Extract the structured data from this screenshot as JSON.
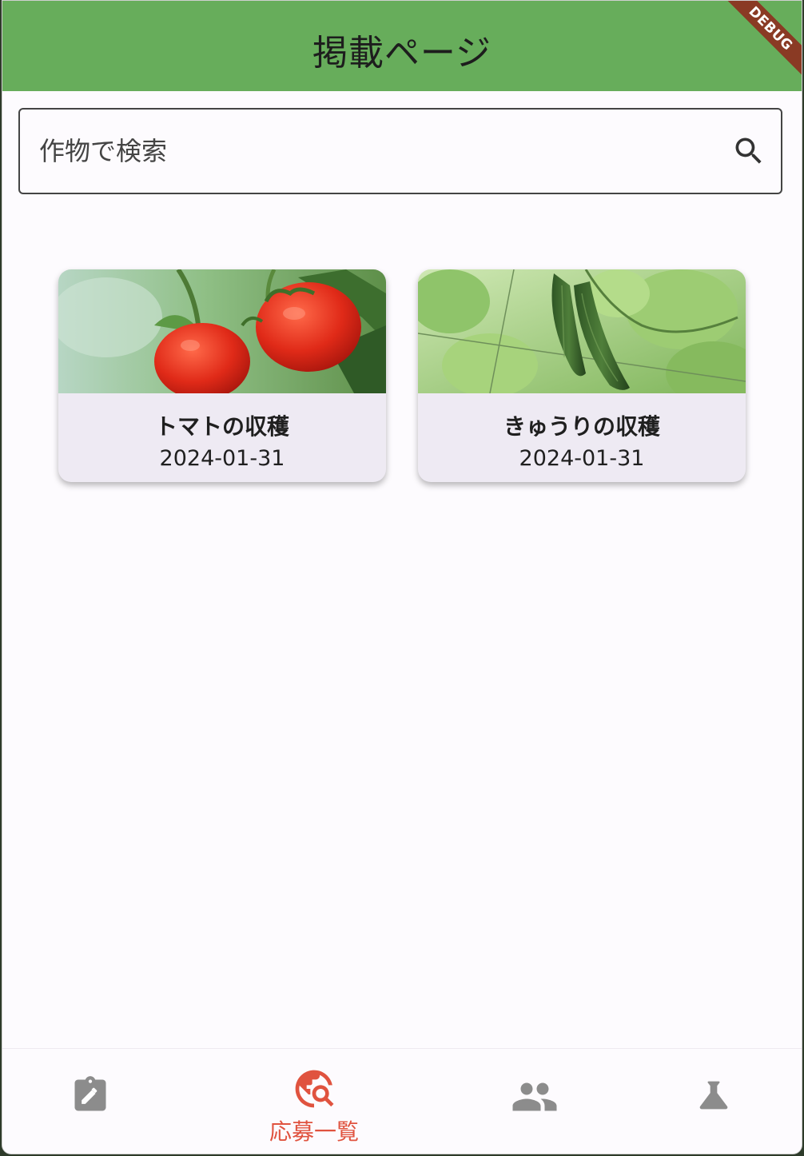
{
  "app": {
    "title": "掲載ページ",
    "debug_label": "DEBUG"
  },
  "search": {
    "placeholder": "作物で検索"
  },
  "cards": [
    {
      "title": "トマトの収穫",
      "date": "2024-01-31",
      "image": "tomato-photo"
    },
    {
      "title": "きゅうりの収穫",
      "date": "2024-01-31",
      "image": "cucumber-photo"
    }
  ],
  "nav": {
    "items": [
      {
        "icon": "assignment-edit-icon",
        "label": "",
        "active": false
      },
      {
        "icon": "travel-explore-icon",
        "label": "応募一覧",
        "active": true
      },
      {
        "icon": "people-icon",
        "label": "",
        "active": false
      },
      {
        "icon": "flask-icon",
        "label": "",
        "active": false
      }
    ]
  },
  "colors": {
    "appbar": "#67ad5b",
    "active": "#e0533f",
    "inactive": "#8c8c8c",
    "card_bg": "#eeeaf3",
    "debug_banner": "#8a3a24"
  }
}
